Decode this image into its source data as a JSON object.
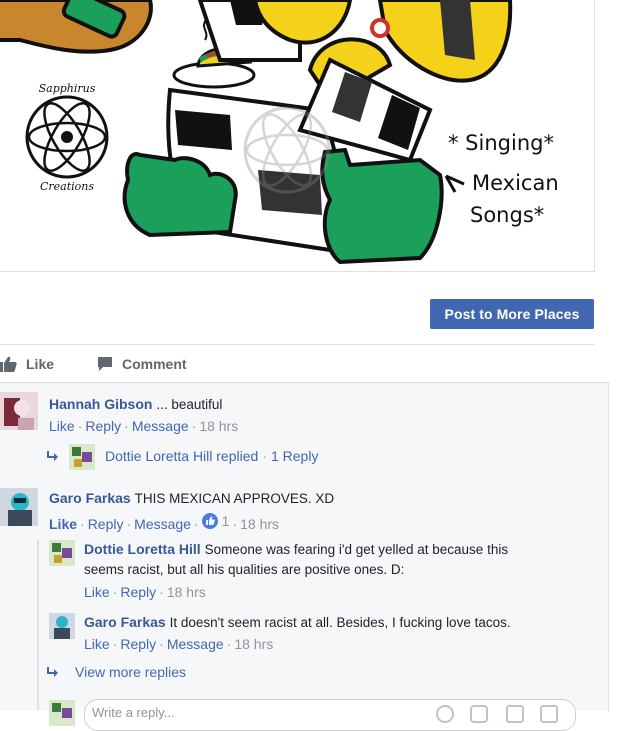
{
  "post_image": {
    "caption_lines": [
      "* Singing*",
      "Mexican",
      "Songs*"
    ],
    "watermark_top": "Sapphirus",
    "watermark_bottom": "Creations",
    "colors": {
      "green": "#1aa05a",
      "yellow": "#f4d21a",
      "brown": "#c8872c",
      "black": "#111111",
      "gray": "#bdbdbd"
    }
  },
  "actions": {
    "post_button": "Post to More Places",
    "like": "Like",
    "comment": "Comment"
  },
  "comments": [
    {
      "name": "Hannah Gibson",
      "text": "... beautiful",
      "like": "Like",
      "reply": "Reply",
      "message": "Message",
      "time": "18 hrs",
      "replies_summary": {
        "name": "Dottie Loretta Hill replied",
        "count": "1 Reply"
      }
    },
    {
      "name": "Garo Farkas",
      "text": "THIS MEXICAN APPROVES. XD",
      "like": "Like",
      "reply": "Reply",
      "message": "Message",
      "reactions": "1",
      "time": "18 hrs",
      "replies": [
        {
          "name": "Dottie Loretta Hill",
          "text_line1": "Someone was fearing i'd get yelled at because this",
          "text_line2": "seems racist, but all his qualities are positive ones. D:",
          "like": "Like",
          "reply": "Reply",
          "time": "18 hrs"
        },
        {
          "name": "Garo Farkas",
          "text": "It doesn't seem racist at all. Besides, I fucking love tacos.",
          "like": "Like",
          "reply": "Reply",
          "message": "Message",
          "time": "18 hrs"
        }
      ],
      "view_more": "View more replies"
    }
  ],
  "write_box": {
    "placeholder": "Write a reply..."
  }
}
